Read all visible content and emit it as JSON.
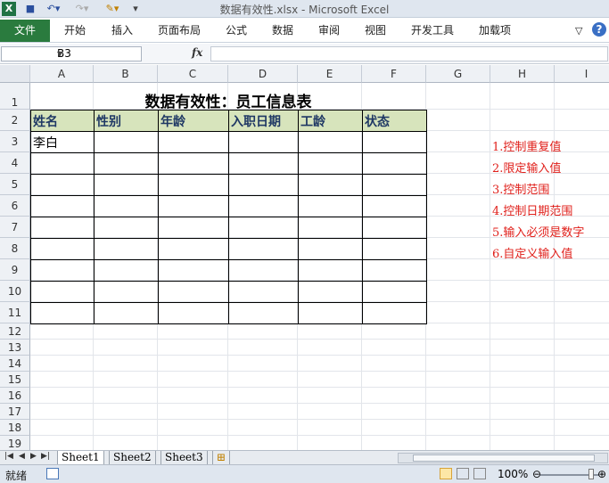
{
  "window": {
    "title": "数据有效性.xlsx - Microsoft Excel"
  },
  "ribbon": {
    "file_label": "文件",
    "tabs": [
      "开始",
      "插入",
      "页面布局",
      "公式",
      "数据",
      "审阅",
      "视图",
      "开发工具",
      "加载项"
    ]
  },
  "formula": {
    "namebox": "B3",
    "fx": "fx",
    "content": ""
  },
  "columns": [
    "A",
    "B",
    "C",
    "D",
    "E",
    "F",
    "G",
    "H",
    "I"
  ],
  "rows": [
    "1",
    "2",
    "3",
    "4",
    "5",
    "6",
    "7",
    "8",
    "9",
    "10",
    "11",
    "12",
    "13",
    "14",
    "15",
    "16",
    "17",
    "18",
    "19"
  ],
  "sheet": {
    "title": "数据有效性：员工信息表",
    "headers": [
      "姓名",
      "性别",
      "年龄",
      "入职日期",
      "工龄",
      "状态"
    ],
    "first_row": [
      "李白",
      "",
      "",
      "",
      "",
      ""
    ]
  },
  "notes": [
    "1.控制重复值",
    "2.限定输入值",
    "3.控制范围",
    "4.控制日期范围",
    "5.输入必须是数字",
    "6.自定义输入值"
  ],
  "sheet_tabs": [
    "Sheet1",
    "Sheet2",
    "Sheet3"
  ],
  "status": {
    "label": "就绪",
    "zoom": "100%"
  }
}
